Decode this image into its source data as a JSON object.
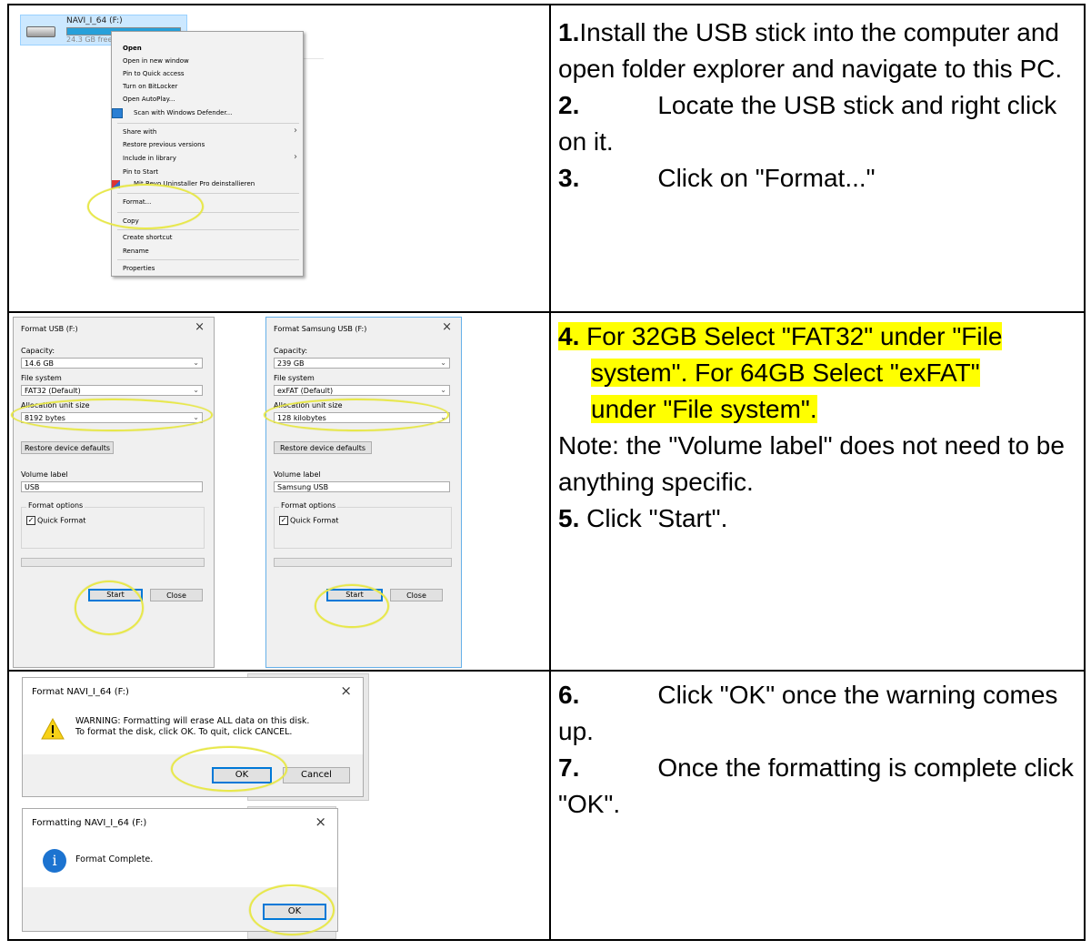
{
  "step1": {
    "drive": {
      "name": "NAVI_I_64 (F:)",
      "free": "24.3 GB free of"
    },
    "menu": {
      "items": [
        "Open",
        "Open in new window",
        "Pin to Quick access",
        "Turn on BitLocker",
        "Open AutoPlay...",
        "Scan with Windows Defender...",
        "Share with",
        "Restore previous versions",
        "Include in library",
        "Pin to Start",
        "Mit Revo Uninstaller Pro deinstallieren",
        "Format...",
        "Copy",
        "Create shortcut",
        "Rename",
        "Properties"
      ]
    }
  },
  "text1": {
    "s1_num": "1.",
    "s1": "Install the USB stick into the computer and open folder explorer and navigate to this PC.",
    "s2_num": "2.",
    "s2": "Locate the USB stick and right click on it.",
    "s3_num": "3.",
    "s3": "Click on \"Format...\""
  },
  "dialog_left": {
    "title": "Format USB (F:)",
    "capacity_label": "Capacity:",
    "capacity": "14.6 GB",
    "fs_label": "File system",
    "fs": "FAT32 (Default)",
    "alloc_label": "Allocation unit size",
    "alloc": "8192 bytes",
    "restore": "Restore device defaults",
    "volume_label": "Volume label",
    "volume": "USB",
    "options_label": "Format options",
    "quick": "Quick Format",
    "start": "Start",
    "close": "Close"
  },
  "dialog_right": {
    "title": "Format Samsung USB (F:)",
    "capacity_label": "Capacity:",
    "capacity": "239 GB",
    "fs_label": "File system",
    "fs": "exFAT (Default)",
    "alloc_label": "Allocation unit size",
    "alloc": "128 kilobytes",
    "restore": "Restore device defaults",
    "volume_label": "Volume label",
    "volume": "Samsung USB",
    "options_label": "Format options",
    "quick": "Quick Format",
    "start": "Start",
    "close": "Close"
  },
  "text2": {
    "s4_num": "4.",
    "s4a": "For 32GB Select \"FAT32\" under \"File",
    "s4b": "system\". For 64GB Select \"exFAT\"",
    "s4c": "under \"File system\".",
    "note": "Note: the \"Volume label\" does not need to be anything specific.",
    "s5_num": "5.",
    "s5": "Click \"Start\"."
  },
  "warning": {
    "title": "Format NAVI_I_64 (F:)",
    "line1": "WARNING: Formatting will erase ALL data on this disk.",
    "line2": "To format the disk, click OK. To quit, click CANCEL.",
    "ok": "OK",
    "cancel": "Cancel"
  },
  "complete": {
    "title": "Formatting NAVI_I_64 (F:)",
    "text": "Format Complete.",
    "ok": "OK"
  },
  "text3": {
    "s6_num": "6.",
    "s6": "Click \"OK\" once the warning comes up.",
    "s7_num": "7.",
    "s7": "Once the formatting is complete click \"OK\"."
  }
}
